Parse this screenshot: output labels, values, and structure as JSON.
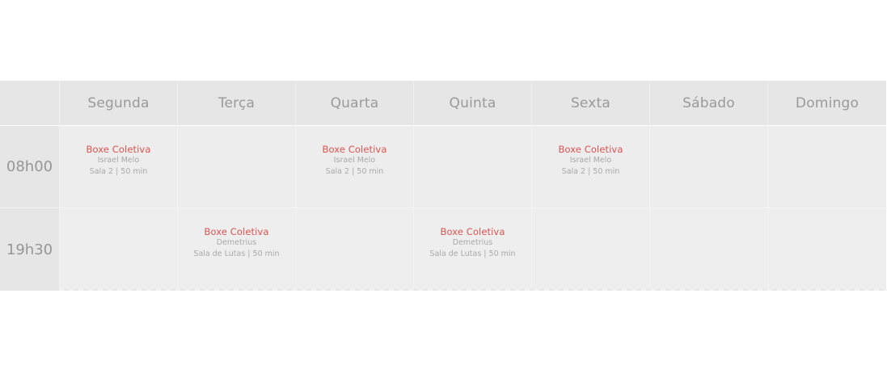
{
  "header": {
    "days": [
      "Segunda",
      "Terça",
      "Quarta",
      "Quinta",
      "Sexta",
      "Sábado",
      "Domingo"
    ]
  },
  "slots": [
    {
      "time": "08h00",
      "cells": [
        {
          "name": "Boxe Coletiva",
          "instructor": "Israel Melo",
          "room": "Sala 2 | 50 min"
        },
        null,
        {
          "name": "Boxe Coletiva",
          "instructor": "Israel Melo",
          "room": "Sala 2 | 50 min"
        },
        null,
        {
          "name": "Boxe Coletiva",
          "instructor": "Israel Melo",
          "room": "Sala 2 | 50 min"
        },
        null,
        null
      ]
    },
    {
      "time": "19h30",
      "cells": [
        null,
        {
          "name": "Boxe Coletiva",
          "instructor": "Demetrius",
          "room": "Sala de Lutas | 50 min"
        },
        null,
        {
          "name": "Boxe Coletiva",
          "instructor": "Demetrius",
          "room": "Sala de Lutas | 50 min"
        },
        null,
        null,
        null
      ]
    }
  ],
  "colors": {
    "class_name": "#d9534f",
    "header_bg": "#e6e6e6",
    "cell_bg": "#ededed",
    "muted_text": "#a9a9a9"
  }
}
